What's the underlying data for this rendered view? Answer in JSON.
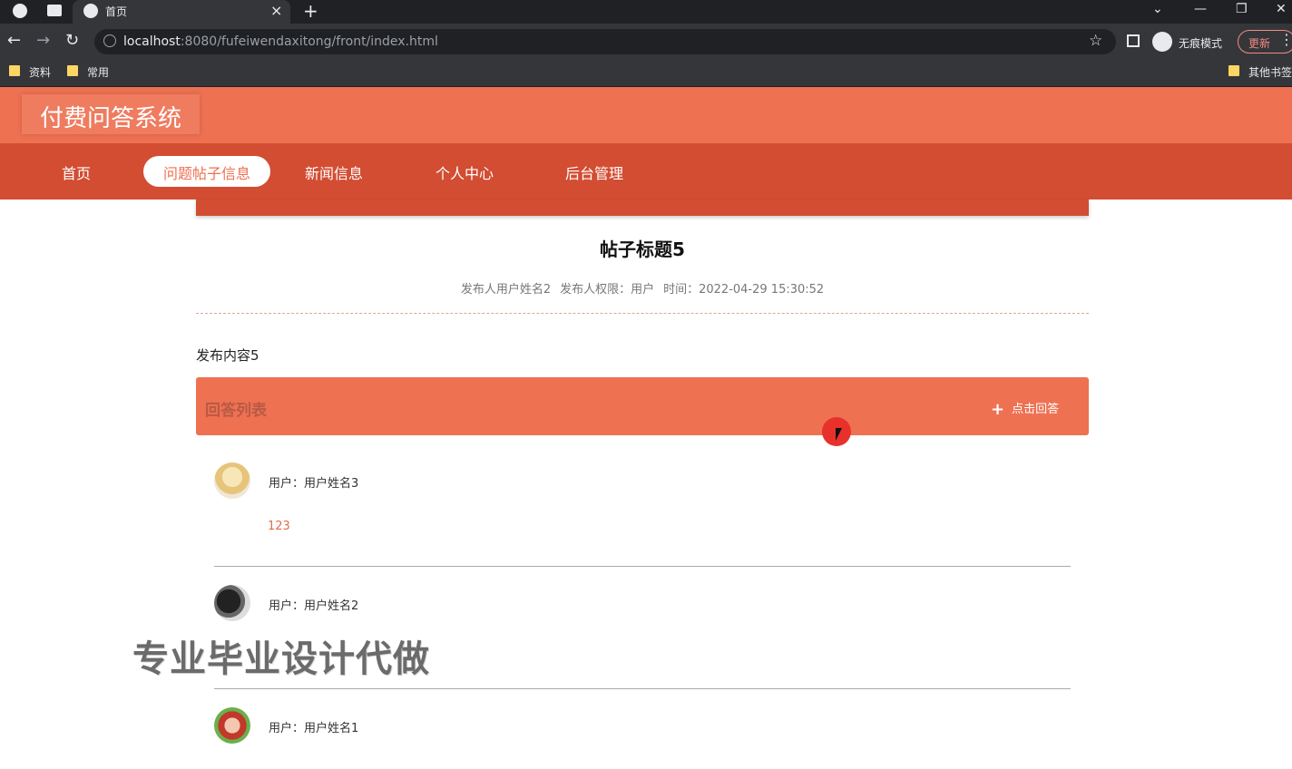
{
  "browser": {
    "tab_title": "首页",
    "url_host": "localhost",
    "url_rest": ":8080/fufeiwendaxitong/front/index.html",
    "incognito_label": "无痕模式",
    "update_label": "更新",
    "bookmarks": [
      "资料",
      "常用",
      "其他书签"
    ]
  },
  "site": {
    "logo": "付费问答系统",
    "nav": [
      "首页",
      "问题帖子信息",
      "新闻信息",
      "个人中心",
      "后台管理"
    ],
    "active_nav": "问题帖子信息"
  },
  "post": {
    "title": "帖子标题5",
    "author": "发布人用户姓名2",
    "role": "发布人权限：用户",
    "time": "时间：2022-04-29 15:30:52",
    "content": "发布内容5"
  },
  "answers": {
    "header": "回答列表",
    "add_label": "点击回答",
    "items": [
      {
        "user": "用户：用户姓名3",
        "text": "123"
      },
      {
        "user": "用户：用户姓名2",
        "text": ""
      },
      {
        "user": "用户：用户姓名1",
        "text": ""
      }
    ]
  },
  "watermark": "专业毕业设计代做",
  "colors": {
    "primary": "#ee7152",
    "nav": "#d24d32"
  }
}
